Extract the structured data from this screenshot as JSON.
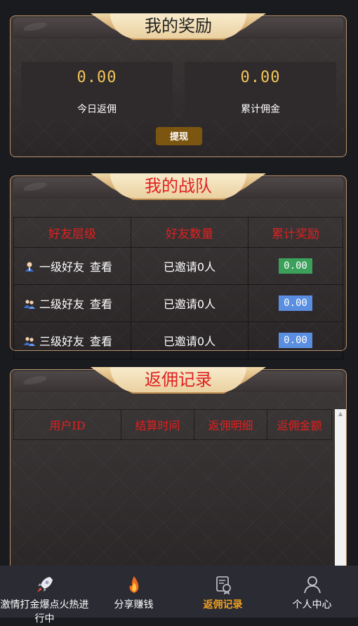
{
  "rewards": {
    "title": "我的奖励",
    "today_value": "0.00",
    "today_label": "今日返佣",
    "total_value": "0.00",
    "total_label": "累计佣金",
    "withdraw_label": "提现"
  },
  "team": {
    "title": "我的战队",
    "headers": [
      "好友层级",
      "好友数量",
      "累计奖励"
    ],
    "rows": [
      {
        "level": "一级好友",
        "view": "查看",
        "count": "已邀请0人",
        "reward": "0.00",
        "reward_color": "#3aa05a",
        "icon": "single-user-icon"
      },
      {
        "level": "二级好友",
        "view": "查看",
        "count": "已邀请0人",
        "reward": "0.00",
        "reward_color": "#5a8ee0",
        "icon": "group-users-icon"
      },
      {
        "level": "三级好友",
        "view": "查看",
        "count": "已邀请0人",
        "reward": "0.00",
        "reward_color": "#5a8ee0",
        "icon": "group-users-icon"
      }
    ]
  },
  "records": {
    "title": "返佣记录",
    "headers": [
      "用户ID",
      "结算时间",
      "返佣明细",
      "返佣金额"
    ]
  },
  "tabbar": {
    "items": [
      {
        "label": "激情打金爆点火热进行中",
        "icon": "rocket-icon",
        "active": false
      },
      {
        "label": "分享赚钱",
        "icon": "flame-icon",
        "active": false
      },
      {
        "label": "返佣记录",
        "icon": "document-icon",
        "active": true
      },
      {
        "label": "个人中心",
        "icon": "person-icon",
        "active": false
      }
    ]
  },
  "colors": {
    "accent_gold": "#f2c65a",
    "active_tab": "#f0a020",
    "header_red": "#e02020",
    "withdraw_button": "#7c5510"
  }
}
